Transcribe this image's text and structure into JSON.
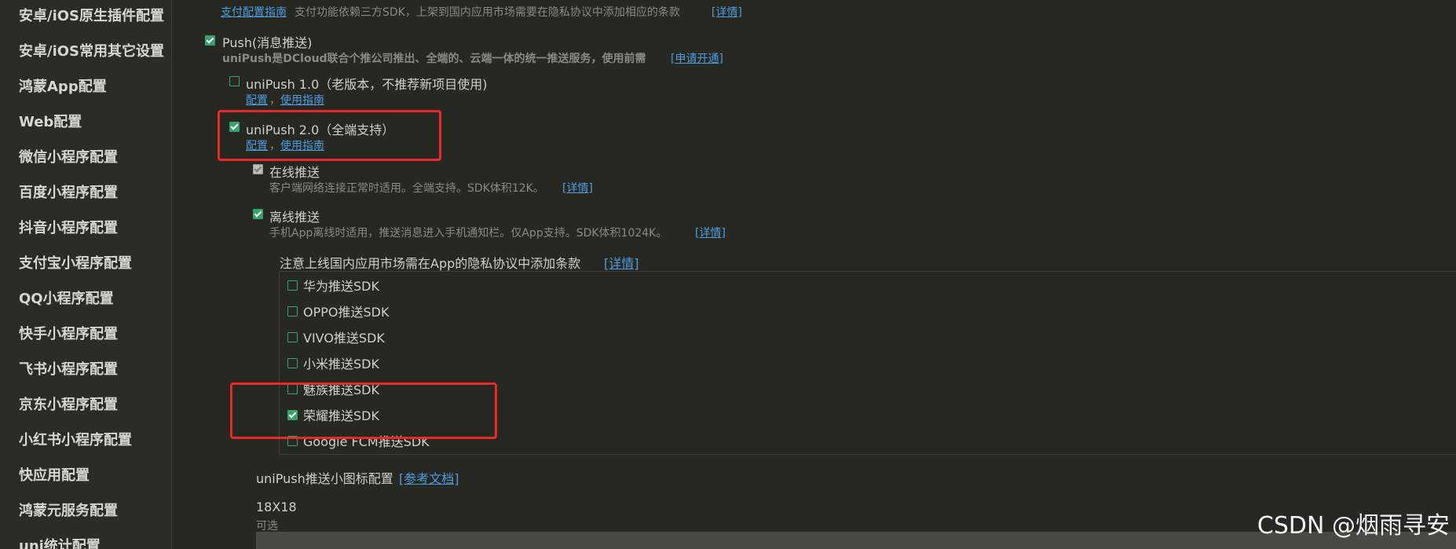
{
  "sidebar": {
    "items": [
      {
        "label": "安卓/iOS原生插件配置"
      },
      {
        "label": "安卓/iOS常用其它设置"
      },
      {
        "label": "鸿蒙App配置"
      },
      {
        "label": "Web配置"
      },
      {
        "label": "微信小程序配置"
      },
      {
        "label": "百度小程序配置"
      },
      {
        "label": "抖音小程序配置"
      },
      {
        "label": "支付宝小程序配置"
      },
      {
        "label": "QQ小程序配置"
      },
      {
        "label": "快手小程序配置"
      },
      {
        "label": "飞书小程序配置"
      },
      {
        "label": "京东小程序配置"
      },
      {
        "label": "小红书小程序配置"
      },
      {
        "label": "快应用配置"
      },
      {
        "label": "鸿蒙元服务配置"
      },
      {
        "label": "uni统计配置"
      }
    ]
  },
  "payment": {
    "guide_link": "支付配置指南",
    "desc": "支付功能依赖三方SDK，上架到国内应用市场需要在隐私协议中添加相应的条款",
    "details_link": "[详情]"
  },
  "push": {
    "label": "Push(消息推送)",
    "checked": true,
    "desc": "uniPush是DCloud联合个推公司推出、全端的、云端一体的统一推送服务，使用前需",
    "desc_bold_prefix": "uniPush",
    "apply_link": "[申请开通]",
    "unipush1": {
      "label": "uniPush 1.0（老版本，不推荐新项目使用)",
      "checked": false,
      "config_link": "配置",
      "sep": "，",
      "guide_link": "使用指南"
    },
    "unipush2": {
      "label": "uniPush 2.0（全端支持）",
      "checked": true,
      "config_link": "配置",
      "sep": "，",
      "guide_link": "使用指南"
    },
    "online": {
      "label": "在线推送",
      "checked": true,
      "disabled": true,
      "desc": "客户端网络连接正常时适用。全端支持。SDK体积12K。",
      "details_link": "[详情]"
    },
    "offline": {
      "label": "离线推送",
      "checked": true,
      "desc": "手机App离线时适用，推送消息进入手机通知栏。仅App支持。SDK体积1024K。",
      "details_link": "[详情]"
    },
    "notice": {
      "text": "注意上线国内应用市场需在App的隐私协议中添加条款",
      "details_link": "[详情]"
    },
    "sdks": [
      {
        "label": "华为推送SDK",
        "checked": false
      },
      {
        "label": "OPPO推送SDK",
        "checked": false
      },
      {
        "label": "VIVO推送SDK",
        "checked": false
      },
      {
        "label": "小米推送SDK",
        "checked": false
      },
      {
        "label": "魅族推送SDK",
        "checked": false
      },
      {
        "label": "荣耀推送SDK",
        "checked": true
      },
      {
        "label": "Google FCM推送SDK",
        "checked": false
      }
    ],
    "small_icon": {
      "label": "uniPush推送小图标配置",
      "doc_link": "[参考文档]",
      "size": "18X18",
      "optional": "可选"
    }
  },
  "colors": {
    "background": "#272822",
    "sidebar": "#2b2c26",
    "checkbox": "#37a36a",
    "link": "#4d9de0",
    "highlight": "#e62a2a"
  },
  "watermark": "CSDN @烟雨寻安"
}
